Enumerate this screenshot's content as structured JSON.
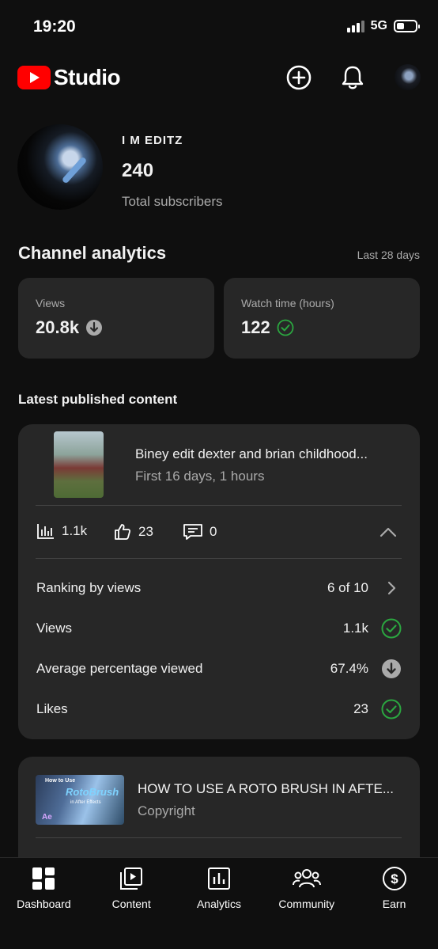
{
  "status_bar": {
    "time": "19:20",
    "network": "5G"
  },
  "header": {
    "brand": "Studio"
  },
  "profile": {
    "channel_name": "I M EDITZ",
    "subscribers": "240",
    "subscribers_label": "Total subscribers"
  },
  "analytics": {
    "title": "Channel analytics",
    "range": "Last 28 days",
    "cards": [
      {
        "label": "Views",
        "value": "20.8k",
        "indicator": "arrow-down-icon"
      },
      {
        "label": "Watch time (hours)",
        "value": "122",
        "indicator": "check-circle-icon"
      }
    ]
  },
  "latest": {
    "title": "Latest published content",
    "items": [
      {
        "title": "Biney edit dexter and brian childhood...",
        "subtitle": "First 16 days, 1 hours",
        "views": "1.1k",
        "likes": "23",
        "comments": "0",
        "metrics": [
          {
            "label": "Ranking by views",
            "value": "6 of 10",
            "indicator": "chevron-right-icon"
          },
          {
            "label": "Views",
            "value": "1.1k",
            "indicator": "check-circle-icon"
          },
          {
            "label": "Average percentage viewed",
            "value": "67.4%",
            "indicator": "arrow-down-icon"
          },
          {
            "label": "Likes",
            "value": "23",
            "indicator": "check-circle-icon"
          }
        ]
      },
      {
        "title": "HOW TO USE A ROTO BRUSH IN AFTE...",
        "subtitle": "Copyright",
        "thumb_text": [
          "How to Use",
          "RotoBrush",
          "in After Effects",
          "Ae"
        ]
      }
    ]
  },
  "nav": [
    "Dashboard",
    "Content",
    "Analytics",
    "Community",
    "Earn"
  ],
  "colors": {
    "background": "#0f0f0f",
    "card": "#272727",
    "brand_red": "#ff0000",
    "success": "#2ba640"
  }
}
